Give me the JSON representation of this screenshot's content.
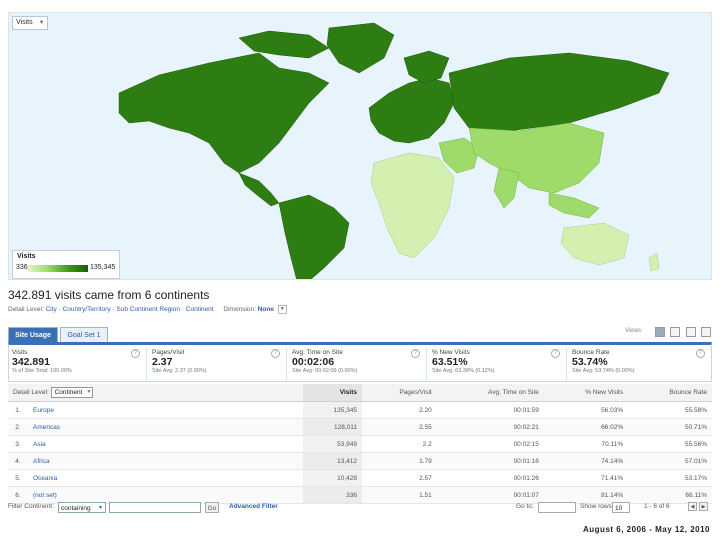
{
  "map": {
    "metric_select": "Visits",
    "legend": {
      "title": "Visits",
      "min": "336",
      "max": "135,345"
    },
    "colors": {
      "ocean": "#e8f4fb",
      "darkest": "#2e7d12",
      "dark": "#3f9a1e",
      "light": "#9edb6a",
      "lightest": "#d4f0b0"
    }
  },
  "headline": "342.891 visits came from 6 continents",
  "drilldown": {
    "prefix": "Detail Level:",
    "path": "City · Country/Territory · Sub Continent Region · Continent",
    "dimension_label": "Dimension:",
    "dimension_value": "None"
  },
  "tabs": [
    {
      "label": "Site Usage",
      "active": true
    },
    {
      "label": "Goal Set 1",
      "active": false
    }
  ],
  "views_label": "Views:",
  "scorecard": [
    {
      "label": "Visits",
      "value": "342.891",
      "sub": "% of Site Total: 100.00%"
    },
    {
      "label": "Pages/Visit",
      "value": "2.37",
      "sub": "Site Avg: 2.37 (0.00%)"
    },
    {
      "label": "Avg. Time on Site",
      "value": "00:02:06",
      "sub": "Site Avg: 00:02:06 (0.00%)"
    },
    {
      "label": "% New Visits",
      "value": "63.51%",
      "sub": "Site Avg: 63.38% (0.12%)"
    },
    {
      "label": "Bounce Rate",
      "value": "53.74%",
      "sub": "Site Avg: 53.74% (0.00%)"
    }
  ],
  "table": {
    "primary_dimension_label": "Detail Level:",
    "primary_dimension": "Continent",
    "columns": [
      "Visits",
      "Pages/Visit",
      "Avg. Time on Site",
      "% New Visits",
      "Bounce Rate"
    ],
    "rows": [
      {
        "n": "1.",
        "name": "Europe",
        "cells": [
          "135,345",
          "2.20",
          "00:01:59",
          "56.03%",
          "55.58%"
        ]
      },
      {
        "n": "2.",
        "name": "Americas",
        "cells": [
          "128,011",
          "2.55",
          "00:02:21",
          "66.02%",
          "50.71%"
        ]
      },
      {
        "n": "3.",
        "name": "Asia",
        "cells": [
          "53,949",
          "2.2",
          "00:02:15",
          "70.11%",
          "55.56%"
        ]
      },
      {
        "n": "4.",
        "name": "Africa",
        "cells": [
          "13,412",
          "1.79",
          "00:01:16",
          "74.14%",
          "57.01%"
        ]
      },
      {
        "n": "5.",
        "name": "Oceania",
        "cells": [
          "10,428",
          "2.57",
          "00:01:26",
          "71.41%",
          "53.17%"
        ]
      },
      {
        "n": "6.",
        "name": "(not set)",
        "cells": [
          "336",
          "1.51",
          "00:01:07",
          "81.14%",
          "66.11%"
        ]
      }
    ]
  },
  "filter": {
    "label": "Filter Continent:",
    "mode": "containing",
    "input_value": "",
    "go": "Go",
    "advanced": "Advanced Filter",
    "goto_label": "Go to:",
    "show_rows_label": "Show rows:",
    "rows": "10",
    "range": "1 - 6 of 6"
  },
  "date_range": "August 6, 2006 - May 12, 2010"
}
